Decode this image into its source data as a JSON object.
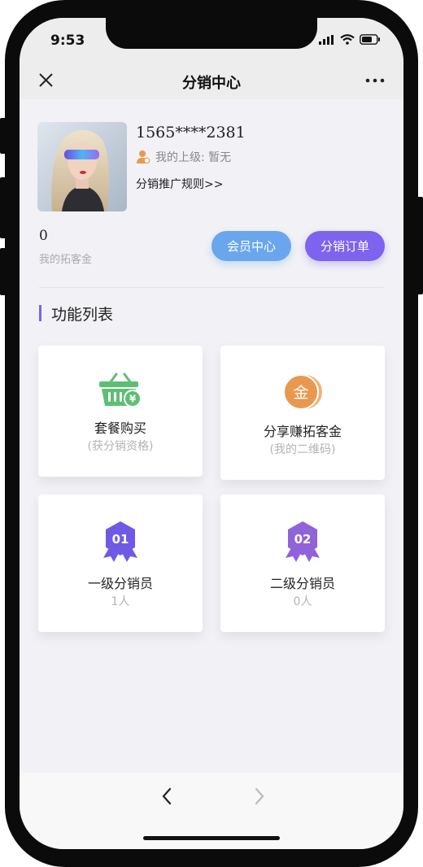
{
  "status_bar": {
    "time": "9:53"
  },
  "nav": {
    "title": "分销中心",
    "close_icon": "close-icon",
    "more_icon": "more-icon"
  },
  "profile": {
    "phone": "1565****2381",
    "superior_label": "我的上级: 暂无",
    "rules_link": "分销推广规则>>"
  },
  "balance": {
    "value": "0",
    "label": "我的拓客金"
  },
  "actions": {
    "member_center": "会员中心",
    "distribution_orders": "分销订单"
  },
  "colors": {
    "accent_purple": "#7d63ee",
    "accent_blue": "#6aa6ee",
    "green": "#5dbf73",
    "orange": "#e8984f"
  },
  "functions": {
    "title": "功能列表",
    "cards": [
      {
        "title": "套餐购买",
        "subtitle": "(获分销资格)",
        "icon": "shopping-basket-icon"
      },
      {
        "title": "分享赚拓客金",
        "subtitle": "(我的二维码)",
        "icon": "gold-coin-icon",
        "icon_text": "金"
      },
      {
        "title": "一级分销员",
        "subtitle": "1人",
        "icon": "level-badge-icon",
        "icon_text": "01"
      },
      {
        "title": "二级分销员",
        "subtitle": "0人",
        "icon": "level-badge-icon",
        "icon_text": "02"
      }
    ]
  },
  "toolbar": {
    "back_icon": "chevron-left-icon",
    "forward_icon": "chevron-right-icon"
  }
}
